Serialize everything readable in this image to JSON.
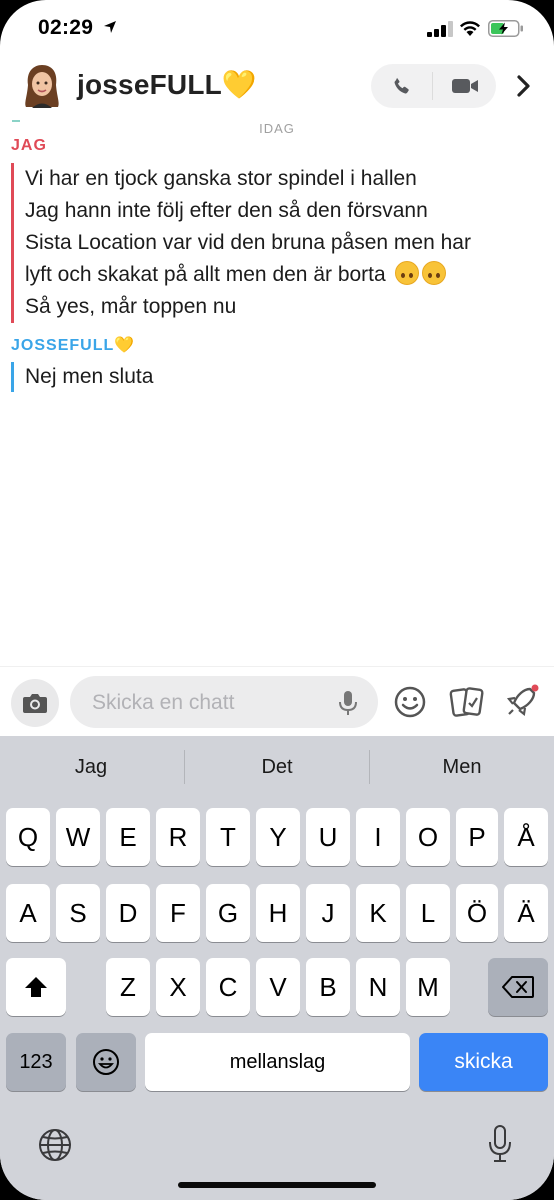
{
  "status_bar": {
    "time": "02:29"
  },
  "header": {
    "contact_name": "josseFULL💛"
  },
  "chat": {
    "date_label": "IDAG",
    "messages": [
      {
        "sender": "JAG",
        "lines": [
          "Vi har en tjock ganska stor spindel i hallen",
          "Jag hann inte följ efter den så den försvann",
          "Sista Location var vid den bruna påsen men har",
          "lyft och skakat på allt men den är borta",
          "Så yes, mår toppen nu"
        ]
      },
      {
        "sender": "JOSSEFULL💛",
        "lines": [
          "Nej men sluta"
        ]
      }
    ]
  },
  "input": {
    "placeholder": "Skicka en chatt"
  },
  "keyboard": {
    "suggestions": [
      "Jag",
      "Det",
      "Men"
    ],
    "row1": [
      "Q",
      "W",
      "E",
      "R",
      "T",
      "Y",
      "U",
      "I",
      "O",
      "P",
      "Å"
    ],
    "row2": [
      "A",
      "S",
      "D",
      "F",
      "G",
      "H",
      "J",
      "K",
      "L",
      "Ö",
      "Ä"
    ],
    "row3": [
      "Z",
      "X",
      "C",
      "V",
      "B",
      "N",
      "M"
    ],
    "numbers_key": "123",
    "space_key": "mellanslag",
    "send_key": "skicka"
  },
  "colors": {
    "me": "#e04a57",
    "friend": "#3aa5e8",
    "send": "#3a85f6"
  },
  "icons": [
    "location-arrow-icon",
    "signal-icon",
    "wifi-icon",
    "battery-charging-icon",
    "phone-icon",
    "video-icon",
    "chevron-right-icon",
    "camera-icon",
    "microphone-icon",
    "smiley-icon",
    "cards-icon",
    "rocket-icon",
    "shift-icon",
    "backspace-icon",
    "emoji-keyboard-icon",
    "globe-icon"
  ]
}
